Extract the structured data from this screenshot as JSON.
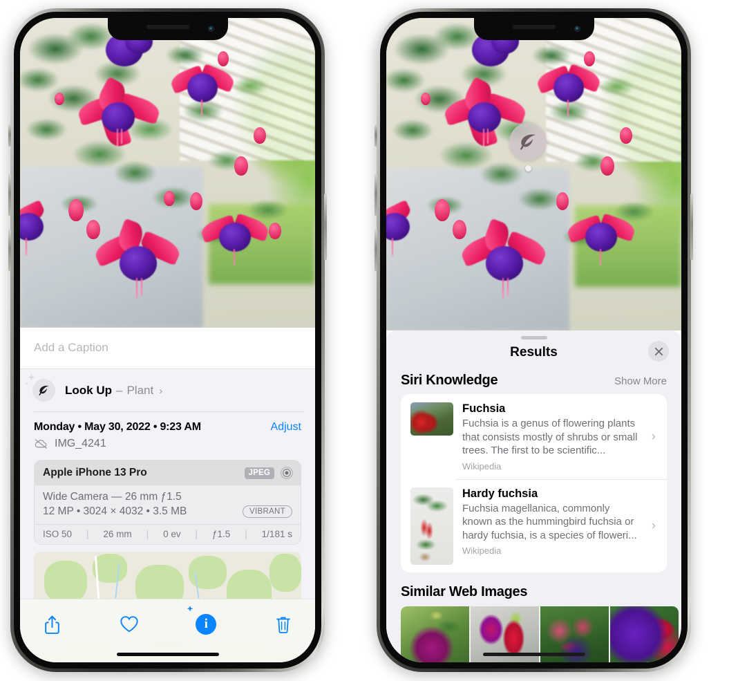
{
  "left_phone": {
    "name": "photos-detail-view",
    "caption": {
      "placeholder": "Add a Caption",
      "value": ""
    },
    "lookup": {
      "icon": "leaf-icon",
      "label": "Look Up",
      "separator": "–",
      "subject": "Plant",
      "chevron": "chevron-right-icon"
    },
    "date": {
      "text": "Monday • May 30, 2022 • 9:23 AM",
      "adjust_label": "Adjust"
    },
    "file": {
      "icon": "cloud-slash-icon",
      "name": "IMG_4241"
    },
    "metadata": {
      "device": "Apple iPhone 13 Pro",
      "format_badge": "JPEG",
      "lens_icon": "camera-lens-icon",
      "lens_line": "Wide Camera — 26 mm ƒ1.5",
      "specs_line": "12 MP • 3024 × 4032 • 3.5 MB",
      "style_pill": "VIBRANT",
      "exif": [
        "ISO 50",
        "26 mm",
        "0 ev",
        "ƒ1.5",
        "1/181 s"
      ],
      "exif_separator": "|"
    },
    "map": {
      "name": "location-map-thumbnail",
      "pin": "photo-pin"
    },
    "toolbar": [
      {
        "name": "share-button",
        "icon": "share-icon"
      },
      {
        "name": "favorite-button",
        "icon": "heart-icon"
      },
      {
        "name": "info-button",
        "icon": "info-sparkle-icon",
        "glyph": "i"
      },
      {
        "name": "delete-button",
        "icon": "trash-icon"
      }
    ]
  },
  "right_phone": {
    "name": "visual-lookup-results-view",
    "photo_badge": {
      "icon": "leaf-icon",
      "name": "visual-lookup-badge"
    },
    "sheet": {
      "grabber": "sheet-grabber",
      "title": "Results",
      "close_icon": "close-icon"
    },
    "siri_knowledge": {
      "title": "Siri Knowledge",
      "show_more": "Show More",
      "items": [
        {
          "title": "Fuchsia",
          "description": "Fuchsia is a genus of flowering plants that consists mostly of shrubs or small trees. The first to be scientific...",
          "source": "Wikipedia",
          "thumbnail": "fuchsia-flowers-thumbnail",
          "chevron": "chevron-right-icon"
        },
        {
          "title": "Hardy fuchsia",
          "description": "Fuchsia magellanica, commonly known as the hummingbird fuchsia or hardy fuchsia, is a species of floweri...",
          "source": "Wikipedia",
          "thumbnail": "hardy-fuchsia-thumbnail",
          "chevron": "chevron-right-icon"
        }
      ]
    },
    "similar_web_images": {
      "title": "Similar Web Images",
      "items": [
        {
          "name": "web-image-1"
        },
        {
          "name": "web-image-2"
        },
        {
          "name": "web-image-3"
        },
        {
          "name": "web-image-4"
        }
      ]
    }
  },
  "colors": {
    "accent_blue": "#0a84ff",
    "sheet_bg": "#f1f1f5",
    "card_bg": "#ffffff",
    "secondary_text": "#6f6f75"
  }
}
